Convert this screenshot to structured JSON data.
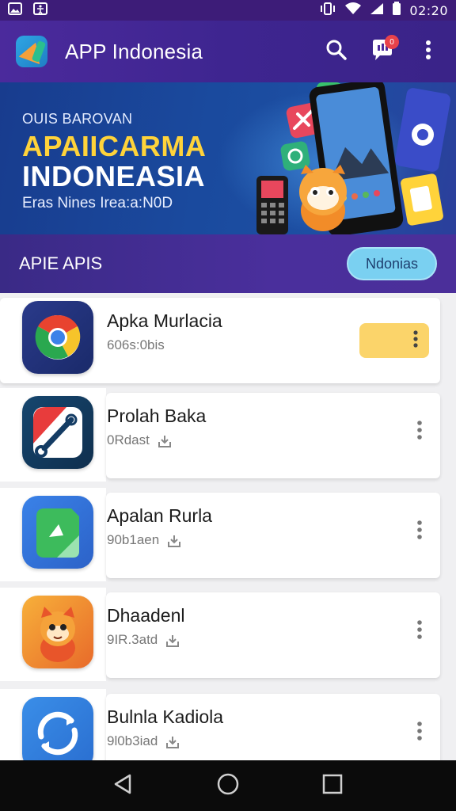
{
  "status_bar": {
    "time": "02:20",
    "icons": [
      "image-icon",
      "accessibility-icon",
      "vibrate-icon",
      "wifi-icon",
      "signal-icon",
      "battery-icon"
    ]
  },
  "app_bar": {
    "title": "APP Indonesia",
    "notification_count": "0",
    "accent": "#4b2a9c"
  },
  "banner": {
    "eyebrow": "OUIS BAROVAN",
    "title_line1": "APAIICARMA",
    "title_line2": "INDONEASIA",
    "subtitle": "Eras Nines Irea:a:N0D",
    "accent": "#ffd33a"
  },
  "section": {
    "title": "APIE APIS",
    "pill_label": "Ndonias"
  },
  "apps": [
    {
      "name": "Apka Murlacia",
      "meta": "606s:0bis",
      "icon": "browser-icon",
      "highlighted": true
    },
    {
      "name": "Prolah Baka",
      "meta": "0Rdast",
      "icon": "brush-icon",
      "highlighted": false
    },
    {
      "name": "Apalan Rurla",
      "meta": "90b1aen",
      "icon": "maps-icon",
      "highlighted": false
    },
    {
      "name": "Dhaadenl",
      "meta": "9IR.3atd",
      "icon": "mascot-icon",
      "highlighted": false
    },
    {
      "name": "Bulnla Kadiola",
      "meta": "9l0b3iad",
      "icon": "sync-icon",
      "highlighted": false
    }
  ],
  "nav_bar": {
    "buttons": [
      "back-icon",
      "home-icon",
      "recents-icon"
    ]
  }
}
